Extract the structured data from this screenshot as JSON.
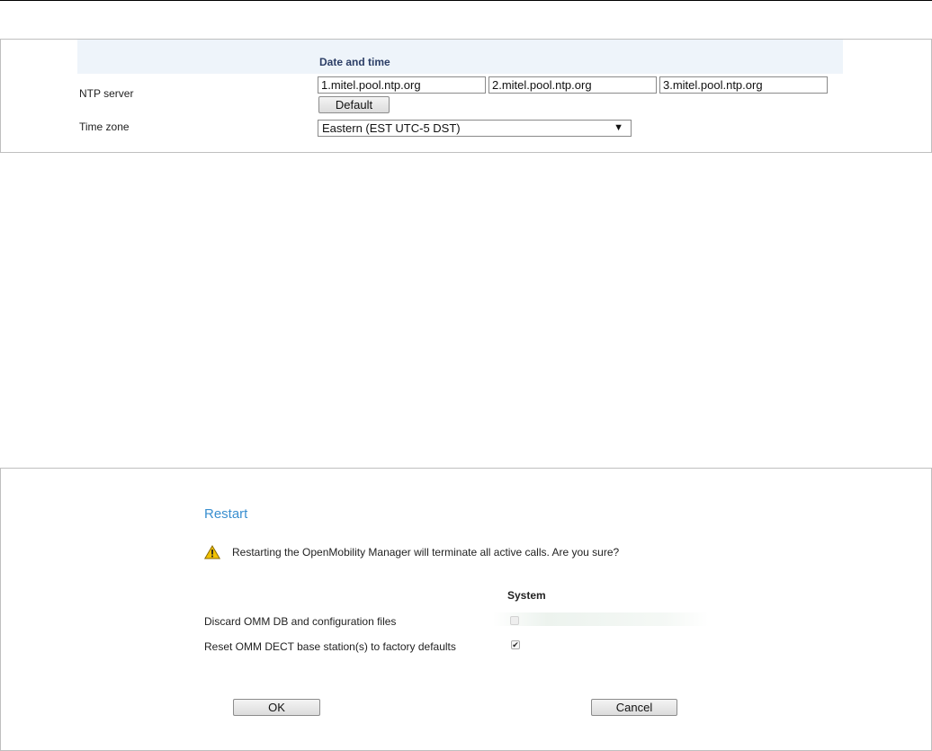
{
  "date_time": {
    "heading": "Date and time",
    "ntp_label": "NTP server",
    "ntp_servers": [
      "1.mitel.pool.ntp.org",
      "2.mitel.pool.ntp.org",
      "3.mitel.pool.ntp.org"
    ],
    "default_button": "Default",
    "timezone_label": "Time zone",
    "timezone_value": "Eastern (EST UTC-5 DST)",
    "dropdown_glyph": "▼"
  },
  "restart": {
    "title": "Restart",
    "warning": "Restarting the OpenMobility Manager will terminate all active calls. Are you sure?",
    "column_header": "System",
    "options": [
      {
        "label": "Discard OMM DB and configuration files",
        "checked": false,
        "enabled": false
      },
      {
        "label": "Reset OMM DECT base station(s) to factory defaults",
        "checked": true,
        "enabled": true
      }
    ],
    "ok_button": "OK",
    "cancel_button": "Cancel"
  },
  "colors": {
    "title_blue": "#3a8fd0",
    "heading_navy": "#2c3e66",
    "row_stripe": "#eef4fa",
    "warning_yellow": "#f2c200"
  }
}
